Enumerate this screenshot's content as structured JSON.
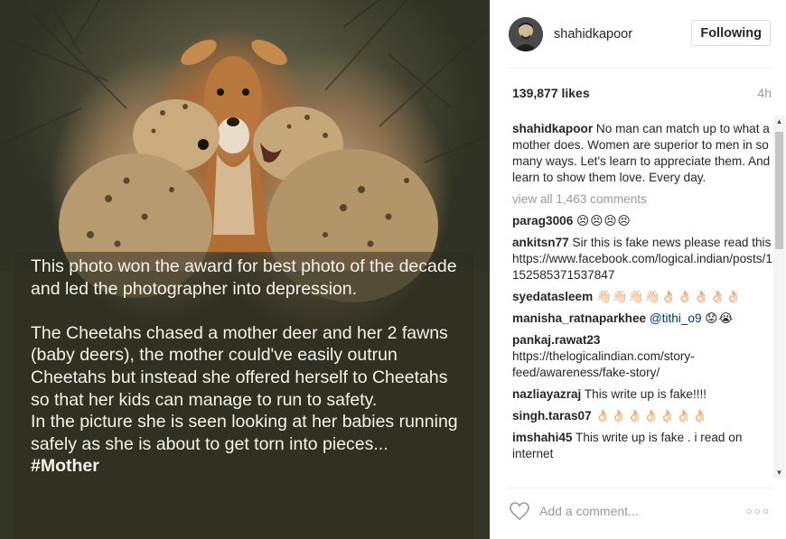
{
  "post": {
    "photo": {
      "overlay": {
        "line1": "This photo won the award for best photo of the decade and led the photographer into depression.",
        "line2": "The Cheetahs chased a mother deer and her 2 fawns (baby deers), the mother could've easily outrun Cheetahs but instead she offered herself to Cheetahs so that her kids can manage to run to safety.",
        "line3": "In the picture she is seen looking at her babies running safely as she is about to get torn into pieces...",
        "hashtag": "#Mother"
      }
    },
    "header": {
      "username": "shahidkapoor",
      "follow_label": "Following"
    },
    "likes": "139,877 likes",
    "time": "4h",
    "caption": {
      "user": "shahidkapoor",
      "text": "No man can match up to what a mother does. Women are superior to men in so many ways. Let's learn to appreciate them. And learn to show them love. Every day."
    },
    "view_all": "view all 1,463 comments",
    "comments": [
      {
        "user": "parag3006",
        "text": "😣😣😣😣"
      },
      {
        "user": "ankitsn77",
        "text": "Sir this is fake news please read this https://www.facebook.com/logical.indian/posts/1152585371537847"
      },
      {
        "user": "syedatasleem",
        "text": "👋🏻👋🏻👋🏻👋🏻👌🏻👌🏻👌🏻👌🏻👌🏻"
      },
      {
        "user": "manisha_ratnaparkhee",
        "mention": "@tithi_o9",
        "text": "😟😭"
      },
      {
        "user": "pankaj.rawat23",
        "text": "https://thelogicalindian.com/story-feed/awareness/fake-story/"
      },
      {
        "user": "nazliayazraj",
        "text": "This write up is fake!!!!"
      },
      {
        "user": "singh.taras07",
        "text": "👌🏻👌🏻👌🏻👌🏻👌🏻👌🏻👌🏻"
      },
      {
        "user": "imshahi45",
        "text": "This write up is fake . i read on internet"
      }
    ],
    "footer": {
      "add_comment_placeholder": "Add a comment...",
      "more_label": "○○○"
    }
  }
}
